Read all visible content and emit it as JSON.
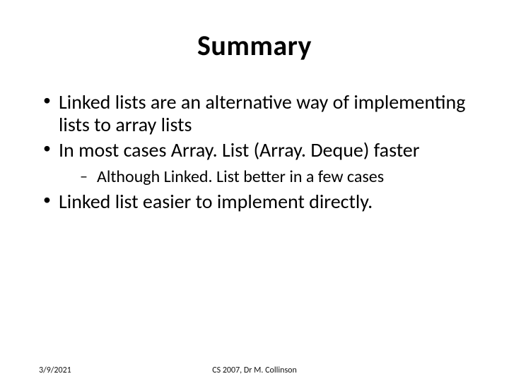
{
  "title": "Summary",
  "bullets": [
    {
      "text": "Linked lists are an alternative way of implementing lists to array lists"
    },
    {
      "text": "In most cases Array. List (Array. Deque) faster",
      "sub": [
        {
          "text": "Although Linked. List better in a few cases"
        }
      ]
    },
    {
      "text": "Linked list easier to implement directly."
    }
  ],
  "footer": {
    "date": "3/9/2021",
    "center": "CS 2007,  Dr M. Collinson"
  }
}
